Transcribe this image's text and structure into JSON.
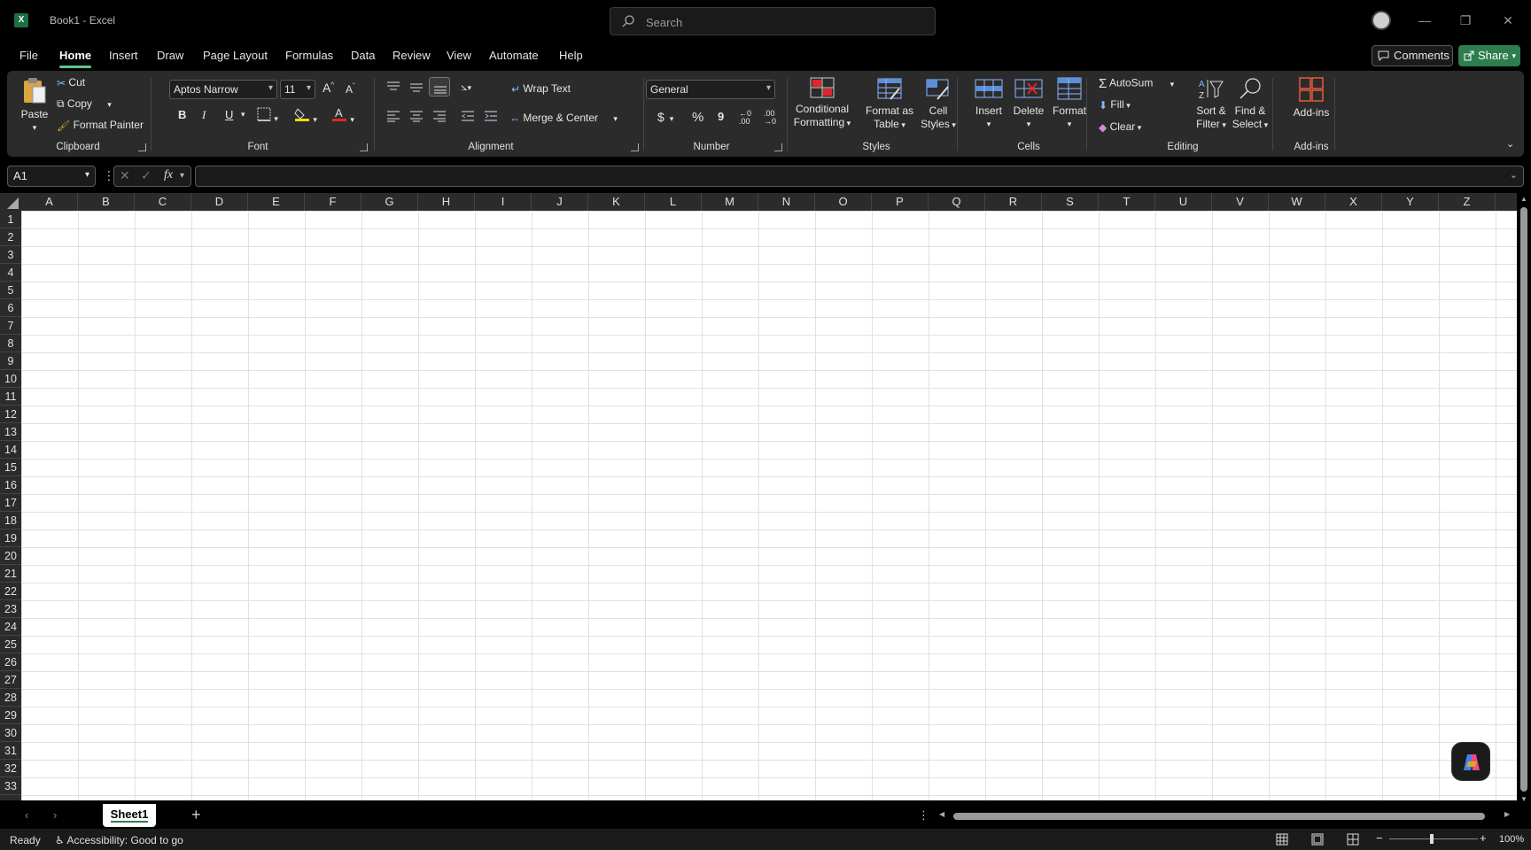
{
  "window": {
    "title": "Book1  -  Excel",
    "app_icon": "X",
    "minimize": "—",
    "restore": "❐",
    "close": "✕"
  },
  "search": {
    "placeholder": "Search"
  },
  "menu": {
    "tabs": [
      "File",
      "Home",
      "Insert",
      "Draw",
      "Page Layout",
      "Formulas",
      "Data",
      "Review",
      "View",
      "Automate",
      "Help"
    ],
    "active": "Home",
    "comments_label": "Comments",
    "share_label": "Share"
  },
  "ribbon": {
    "clipboard": {
      "paste": "Paste",
      "cut": "Cut",
      "copy": "Copy",
      "format_painter": "Format Painter",
      "label": "Clipboard"
    },
    "font": {
      "font_name": "Aptos Narrow",
      "font_size": "11",
      "grow": "A",
      "shrink": "A",
      "bold": "B",
      "italic": "I",
      "underline": "U",
      "label": "Font"
    },
    "alignment": {
      "wrap_text": "Wrap Text",
      "merge_center": "Merge & Center",
      "label": "Alignment"
    },
    "number": {
      "format": "General",
      "currency": "$",
      "percent": "%",
      "comma": "9",
      "label": "Number"
    },
    "styles": {
      "conditional": "Conditional",
      "conditional2": "Formatting",
      "format_table": "Format as",
      "format_table2": "Table",
      "cell_styles": "Cell",
      "cell_styles2": "Styles",
      "label": "Styles"
    },
    "cells": {
      "insert": "Insert",
      "delete": "Delete",
      "format": "Format",
      "label": "Cells"
    },
    "editing": {
      "autosum": "AutoSum",
      "fill": "Fill",
      "clear": "Clear",
      "sort": "Sort &",
      "sort2": "Filter",
      "find": "Find &",
      "find2": "Select",
      "label": "Editing"
    },
    "addins": {
      "addins": "Add-ins",
      "label": "Add-ins"
    },
    "colors": {
      "highlight": "#f5d90a",
      "font_color": "#e0262b",
      "accent": "#5ec48b"
    }
  },
  "formula_bar": {
    "name_box": "A1",
    "fx": "fx",
    "value": ""
  },
  "grid": {
    "columns": [
      "A",
      "B",
      "C",
      "D",
      "E",
      "F",
      "G",
      "H",
      "I",
      "J",
      "K",
      "L",
      "M",
      "N",
      "O",
      "P",
      "Q",
      "R",
      "S",
      "T",
      "U",
      "V",
      "W",
      "X",
      "Y",
      "Z"
    ],
    "rows": [
      "1",
      "2",
      "3",
      "4",
      "5",
      "6",
      "7",
      "8",
      "9",
      "10",
      "11",
      "12",
      "13",
      "14",
      "15",
      "16",
      "17",
      "18",
      "19",
      "20",
      "21",
      "22",
      "23",
      "24",
      "25",
      "26",
      "27",
      "28",
      "29",
      "30",
      "31",
      "32",
      "33"
    ]
  },
  "sheets": {
    "tabs": [
      "Sheet1"
    ],
    "add": "+"
  },
  "status": {
    "ready": "Ready",
    "accessibility": "Accessibility: Good to go",
    "zoom": "100%"
  }
}
